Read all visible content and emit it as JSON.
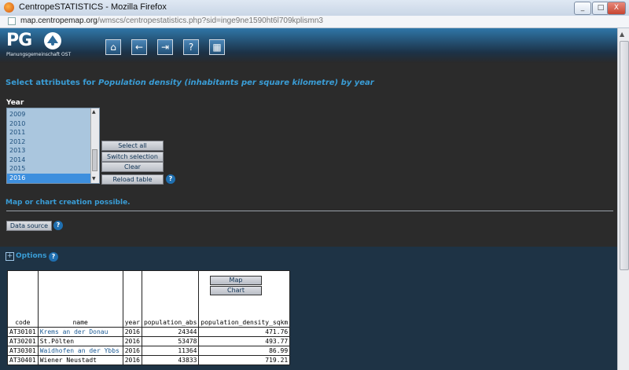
{
  "window": {
    "title": "CentropeSTATISTICS - Mozilla Firefox",
    "buttons": {
      "minimize": "_",
      "maximize": "□",
      "close": "X"
    }
  },
  "address": {
    "host": "map.centropemap.org",
    "path": "/wmscs/centropestatistics.php?sid=inge9ne1590ht6l709kplismn3"
  },
  "logo": {
    "text": "PG",
    "subtitle": "Planungsgemeinschaft OST"
  },
  "nav_icons": [
    {
      "name": "home-icon",
      "glyph": "⌂"
    },
    {
      "name": "back-arrow-icon",
      "glyph": "←"
    },
    {
      "name": "exit-icon",
      "glyph": "⇥"
    },
    {
      "name": "help-icon",
      "glyph": "?"
    },
    {
      "name": "calculator-icon",
      "glyph": "▦"
    }
  ],
  "headline": {
    "prefix": "Select attributes for ",
    "attribute": "Population density (inhabitants per square kilometre) by year"
  },
  "year": {
    "label": "Year",
    "options": [
      "2009",
      "2010",
      "2011",
      "2012",
      "2013",
      "2014",
      "2015",
      "2016"
    ],
    "selected": "2016"
  },
  "buttons": {
    "select_all": "Select all",
    "switch_selection": "Switch selection",
    "clear": "Clear",
    "reload_table": "Reload table",
    "data_source": "Data source",
    "map": "Map",
    "chart": "Chart",
    "help": "?"
  },
  "status": "Map or chart creation possible.",
  "options_label": "Options",
  "options_toggle": "+",
  "table": {
    "columns": [
      "code",
      "name",
      "year",
      "population_abs",
      "population_density_sqkm"
    ],
    "rows": [
      [
        "AT30101",
        "Krems an der Donau",
        "2016",
        "24344",
        "471.76"
      ],
      [
        "AT30201",
        "St.Pölten",
        "2016",
        "53478",
        "493.77"
      ],
      [
        "AT30301",
        "Waidhofen an der Ybbs",
        "2016",
        "11364",
        "86.99"
      ],
      [
        "AT30401",
        "Wiener Neustadt",
        "2016",
        "43833",
        "719.21"
      ]
    ]
  },
  "colors": {
    "accent": "#3a9dd6",
    "background": "#2b2b2b",
    "bottom_panel": "#1e3345",
    "list_bg": "#aac6de",
    "list_selected": "#3d8fde"
  }
}
